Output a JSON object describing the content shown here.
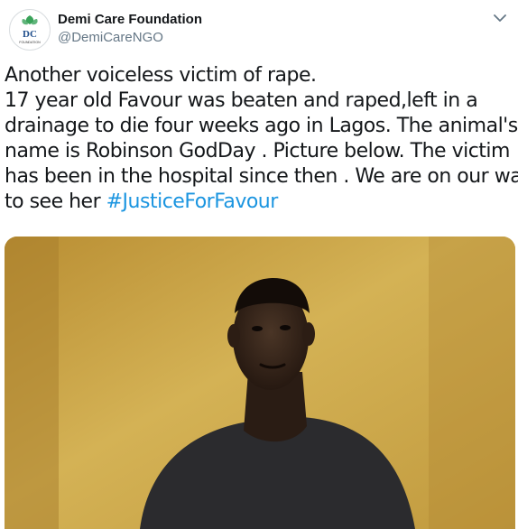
{
  "account": {
    "display_name": "Demi Care Foundation",
    "handle": "@DemiCareNGO",
    "avatar_monogram": "DC",
    "avatar_caption": "FOUNDATION"
  },
  "tweet": {
    "lines": [
      "Another voiceless victim of rape.",
      "17 year old Favour was beaten and raped,left in a",
      "drainage to die four weeks ago in Lagos. The animal's",
      "name is Robinson GodDay . Picture below. The victim",
      "has been in the hospital since then . We are on our way",
      "to see her "
    ],
    "hashtag": "#JusticeForFavour"
  },
  "colors": {
    "link": "#1b95e0",
    "wall": "#c9a344",
    "avatar_green": "#3aa35a"
  },
  "icons": {
    "menu": "chevron-down-icon"
  }
}
